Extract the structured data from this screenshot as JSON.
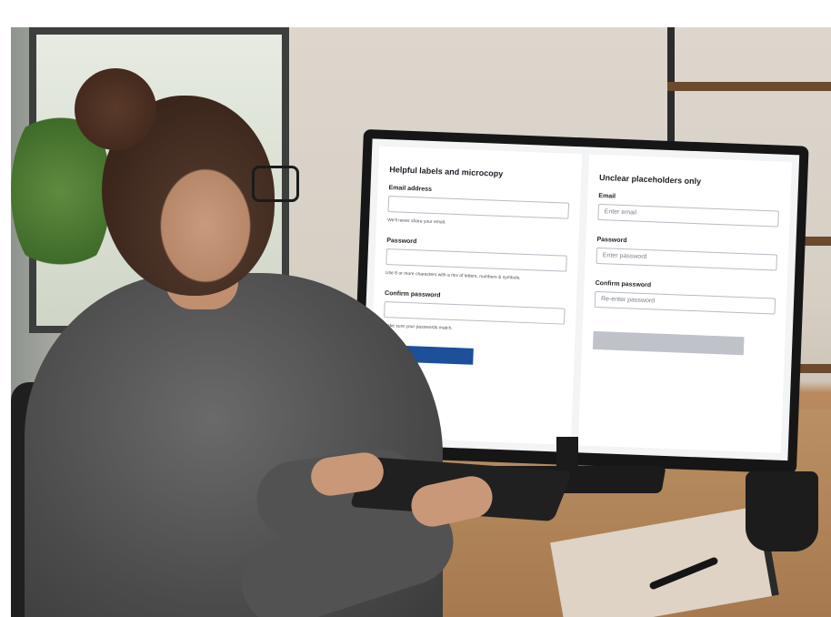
{
  "left_panel": {
    "title": "Helpful labels and microcopy",
    "fields": [
      {
        "label": "Email address",
        "help": "We'll never share your email."
      },
      {
        "label": "Password",
        "help": "Use 8 or more characters with a mix of letters, numbers & symbols."
      },
      {
        "label": "Confirm password",
        "help": "Make sure your passwords match."
      }
    ]
  },
  "right_panel": {
    "title": "Unclear placeholders only",
    "fields": [
      {
        "label": "Email",
        "placeholder": "Enter email"
      },
      {
        "label": "Password",
        "placeholder": "Enter password"
      },
      {
        "label": "Confirm password",
        "placeholder": "Re-enter password"
      }
    ]
  },
  "colors": {
    "primary_button": "#1d4f9a",
    "muted_button": "#bfc3c9"
  }
}
